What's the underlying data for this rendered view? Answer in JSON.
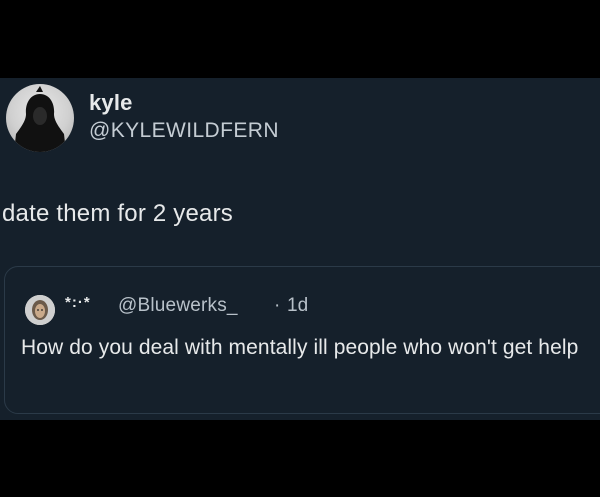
{
  "tweet": {
    "display_name": "kyle",
    "handle": "@KYLEWILDFERN",
    "text": "date them for 2 years"
  },
  "quoted_tweet": {
    "display_name": "*:·*",
    "handle": "@Bluewerks_",
    "separator": "·",
    "time": "1d",
    "text": "How do you deal with mentally ill people who won't get help"
  },
  "colors": {
    "background": "#000000",
    "card": "#15202b",
    "primary_text": "#e7e9ea",
    "secondary_text": "#b8c1c9",
    "quote_border": "#2b3a48"
  }
}
